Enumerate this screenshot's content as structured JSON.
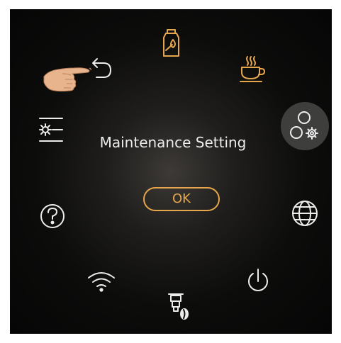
{
  "dialog": {
    "title": "Maintenance Setting",
    "ok_label": "OK"
  },
  "colors": {
    "accent": "#e6a64c",
    "text": "#ececec",
    "active_bg": "#3e3e3d",
    "background": "#0c0c0b"
  },
  "menu": {
    "items": [
      {
        "name": "bean-container-icon",
        "active": false
      },
      {
        "name": "coffee-cup-icon",
        "active": false
      },
      {
        "name": "maintenance-settings-icon",
        "active": true
      },
      {
        "name": "globe-icon",
        "active": false
      },
      {
        "name": "power-icon",
        "active": false
      },
      {
        "name": "filter-icon",
        "active": false
      },
      {
        "name": "wifi-icon",
        "active": false
      },
      {
        "name": "help-icon",
        "active": false
      },
      {
        "name": "settings-list-icon",
        "active": false
      },
      {
        "name": "back-icon",
        "active": false
      }
    ]
  }
}
